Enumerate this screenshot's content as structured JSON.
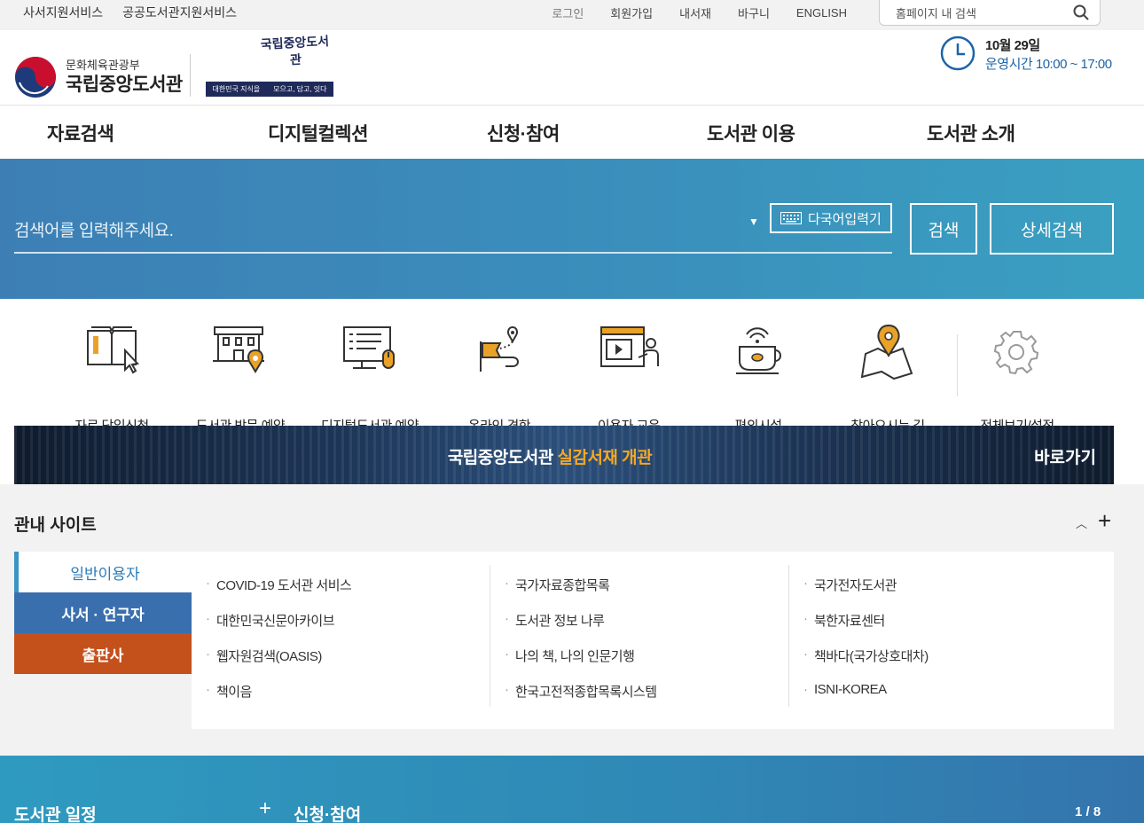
{
  "util": {
    "left_links": [
      "사서지원서비스",
      "공공도서관지원서비스"
    ],
    "right_links": [
      "로그인",
      "회원가입",
      "내서재",
      "바구니",
      "ENGLISH"
    ],
    "search_placeholder": "홈페이지 내 검색"
  },
  "header": {
    "ministry": "문화체육관광부",
    "library_name": "국립중앙도서관",
    "campaign_title": "국립중앙도서관",
    "campaign_left": "대한민국 지식을",
    "campaign_right": "모으고, 담고, 잇다",
    "date": "10월 29일",
    "hours_label": "운영시간",
    "hours_value": "10:00 ~ 17:00"
  },
  "gnb": [
    "자료검색",
    "디지털컬렉션",
    "신청·참여",
    "도서관 이용",
    "도서관 소개"
  ],
  "search": {
    "placeholder": "검색어를 입력해주세요.",
    "multilang_label": "다국어입력기",
    "search_label": "검색",
    "detail_label": "상세검색"
  },
  "quick_menu": [
    {
      "label": "자료 당일신청",
      "icon": "book-request-icon"
    },
    {
      "label": "도서관 방문 예약",
      "icon": "library-visit-icon"
    },
    {
      "label": "디지털도서관 예약",
      "icon": "digital-library-icon"
    },
    {
      "label": "온라인 견학",
      "icon": "online-tour-icon"
    },
    {
      "label": "이용자 교육",
      "icon": "user-education-icon"
    },
    {
      "label": "편의시설",
      "icon": "cafe-icon"
    },
    {
      "label": "찾아오시는 길",
      "icon": "map-pin-icon"
    },
    {
      "label": "전체보기/설정",
      "icon": "gear-icon"
    }
  ],
  "banner": {
    "text_main": "국립중앙도서관",
    "text_highlight": "실감서재 개관",
    "go_label": "바로가기"
  },
  "sites": {
    "title": "관내 사이트",
    "tabs": [
      "일반이용자",
      "사서 · 연구자",
      "출판사"
    ],
    "columns": [
      [
        "COVID-19 도서관 서비스",
        "대한민국신문아카이브",
        "웹자원검색(OASIS)",
        "책이음"
      ],
      [
        "국가자료종합목록",
        "도서관 정보 나루",
        "나의 책, 나의 인문기행",
        "한국고전적종합목록시스템"
      ],
      [
        "국가전자도서관",
        "북한자료센터",
        "책바다(국가상호대차)",
        "ISNI-KOREA"
      ]
    ]
  },
  "bottom": {
    "schedule_title": "도서관 일정",
    "apply_title": "신청·참여",
    "pagination": "1 / 8"
  },
  "colors": {
    "brand_blue": "#3a6fae",
    "hero_blue": "#3a8fbb",
    "publisher_orange": "#c4501b",
    "highlight_orange": "#f6a823",
    "icon_gold": "#e9a227"
  }
}
